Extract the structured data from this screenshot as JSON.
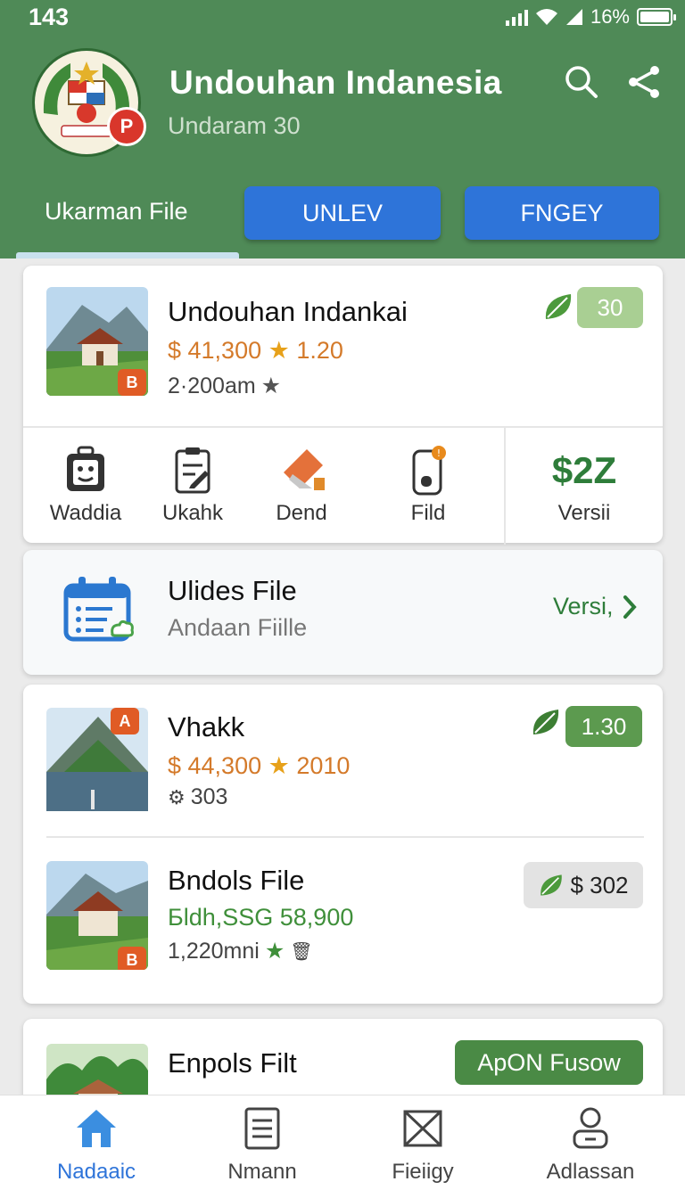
{
  "status_bar": {
    "time": "143",
    "battery": "16%"
  },
  "header": {
    "title": "Undouhan Indanesia",
    "subtitle": "Undaram  30",
    "logo_badge": "P",
    "tabs": [
      "Ukarman File",
      "UNLEV",
      "FNGEY"
    ]
  },
  "card1": {
    "title": "Undouhan Indankai",
    "price": "$ 41,300",
    "rating": "1.20",
    "meta": "2·200am",
    "pill": "30",
    "thumb_badge": "B",
    "actions": [
      {
        "icon": "luggage-icon",
        "label": "Waddia"
      },
      {
        "icon": "clipboard-edit-icon",
        "label": "Ukahk"
      },
      {
        "icon": "tag-icon",
        "label": "Dend"
      },
      {
        "icon": "phone-notification-icon",
        "label": "Fild"
      }
    ],
    "big_price": "$2Z",
    "big_price_label": "Versii"
  },
  "card2": {
    "title": "Ulides File",
    "subtitle": "Andaan Fiille",
    "link": "Versi,"
  },
  "card3": {
    "item1": {
      "title": "Vhakk",
      "price": "$ 44,300",
      "rating": "2010",
      "meta": "303",
      "pill": "1.30",
      "thumb_badge": "A"
    },
    "item2": {
      "title": "Bndols File",
      "price": "Бldh,SSG 58,900",
      "meta": "1,220mni",
      "pill": "$ 302",
      "thumb_badge": "B"
    }
  },
  "card4": {
    "title": "Enpols Filt",
    "button": "ApON Fusow"
  },
  "nav": [
    {
      "icon": "home-icon",
      "label": "Nadaaic"
    },
    {
      "icon": "document-icon",
      "label": "Nmann"
    },
    {
      "icon": "envelope-icon",
      "label": "Fieiigy"
    },
    {
      "icon": "profile-icon",
      "label": "Adlassan"
    }
  ],
  "colors": {
    "header_green": "#4f8a57",
    "accent_blue": "#2e74d9",
    "price_orange": "#d47a2a",
    "price_green": "#2e7d3a"
  }
}
